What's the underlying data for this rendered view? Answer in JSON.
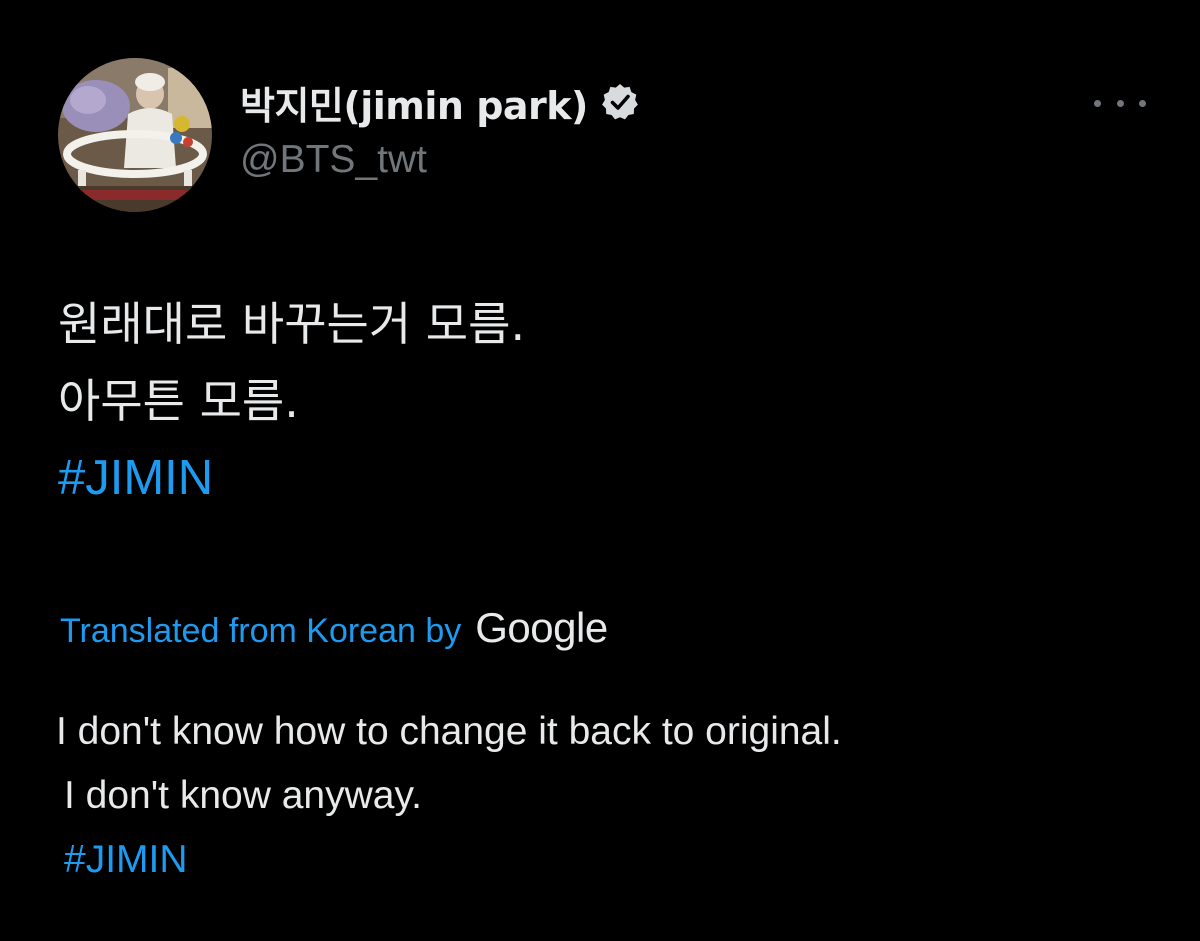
{
  "author": {
    "display_name": "박지민(jimin park)",
    "handle": "@BTS_twt",
    "verified": true,
    "avatar_icon": "baby-photo-avatar"
  },
  "menu": {
    "more_icon": "more-options-icon"
  },
  "tweet": {
    "original_lines": [
      "원래대로 바꾸는거 모름.",
      "아무튼 모름."
    ],
    "hashtag": "#JIMIN",
    "translation_label": "Translated from Korean by",
    "translation_provider": "Google",
    "translated_lines": [
      "I don't know how to change it back to original.",
      "I don't know anyway."
    ],
    "translated_hashtag": "#JIMIN"
  },
  "colors": {
    "background": "#000000",
    "text": "#e7e9ea",
    "secondary": "#71767b",
    "link": "#1d9bf0"
  }
}
